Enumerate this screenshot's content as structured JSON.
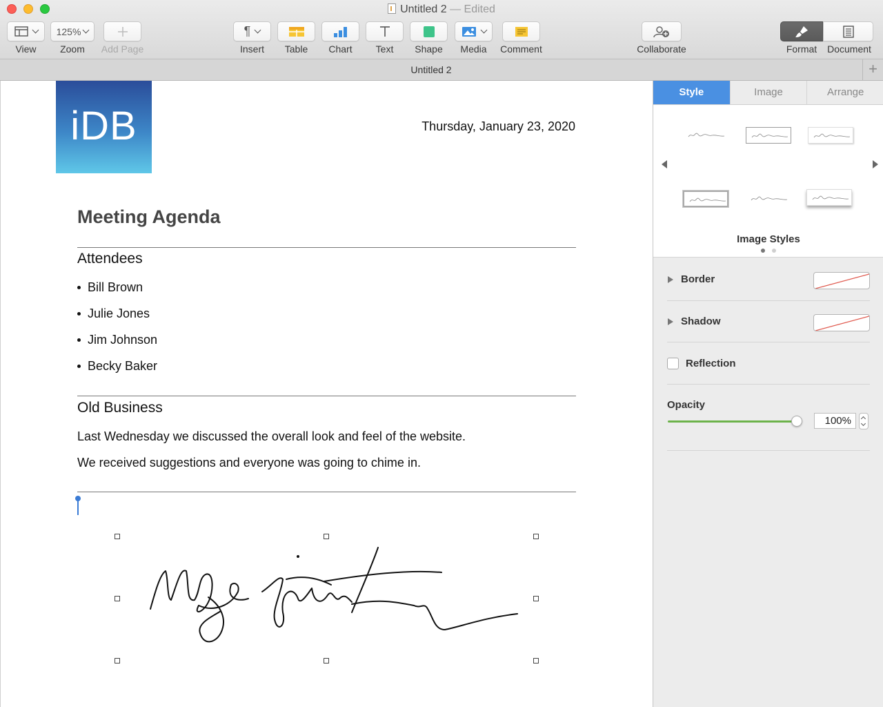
{
  "window": {
    "title": "Untitled 2",
    "edited": "— Edited"
  },
  "toolbar": {
    "view_label": "View",
    "zoom_value": "125%",
    "zoom_label": "Zoom",
    "add_page_label": "Add Page",
    "insert_label": "Insert",
    "table_label": "Table",
    "chart_label": "Chart",
    "text_label": "Text",
    "shape_label": "Shape",
    "media_label": "Media",
    "comment_label": "Comment",
    "collaborate_label": "Collaborate",
    "format_label": "Format",
    "document_label": "Document"
  },
  "tabbar": {
    "title": "Untitled 2",
    "add_symbol": "+"
  },
  "document": {
    "logo_text": "iDB",
    "date": "Thursday, January 23, 2020",
    "title": "Meeting Agenda",
    "attendees_heading": "Attendees",
    "attendees": [
      "Bill Brown",
      "Julie Jones",
      "Jim Johnson",
      "Becky Baker"
    ],
    "old_business_heading": "Old Business",
    "paragraphs": [
      "Last Wednesday we discussed the overall look and feel of the website.",
      "We received suggestions and everyone was going to chime in."
    ]
  },
  "inspector": {
    "tabs": [
      "Style",
      "Image",
      "Arrange"
    ],
    "active_tab": "Style",
    "image_styles_title": "Image Styles",
    "border_label": "Border",
    "shadow_label": "Shadow",
    "reflection_label": "Reflection",
    "reflection_checked": false,
    "opacity_label": "Opacity",
    "opacity_value": "100%",
    "opacity_fraction": 1.0
  },
  "colors": {
    "accent": "#4a90e2",
    "slider": "#6cb24a",
    "logo_top": "#2a4d9a",
    "logo_bottom": "#5fc7e8"
  }
}
